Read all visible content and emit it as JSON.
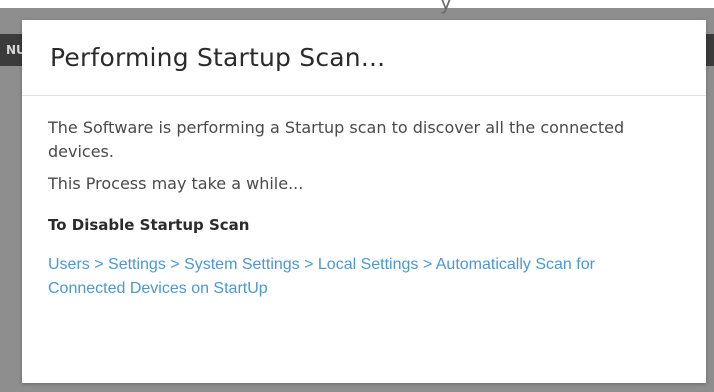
{
  "background": {
    "header_fragment": "NU",
    "top_text_fragment": "y"
  },
  "dialog": {
    "title": "Performing Startup Scan...",
    "description": "The Software is performing a Startup scan to discover all the connected devices.",
    "note": "This Process may take a while...",
    "disable_heading": "To Disable Startup Scan",
    "settings_path": "Users > Settings > System Settings > Local Settings > Automatically Scan for Connected Devices on StartUp"
  },
  "colors": {
    "link": "#4a97d9",
    "backdrop": "#8e8e8e",
    "text": "#4a4a4a"
  }
}
